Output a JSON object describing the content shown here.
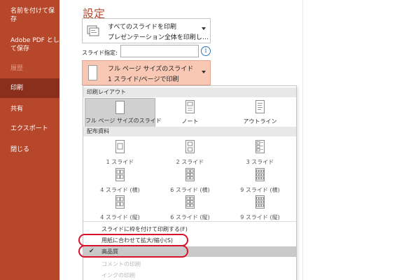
{
  "sidebar": {
    "items": [
      {
        "label": "名前を付けて保\n存"
      },
      {
        "label": "Adobe PDF とし\nて保存"
      },
      {
        "label": "履歴"
      },
      {
        "label": "印刷"
      },
      {
        "label": "共有"
      },
      {
        "label": "エクスポート"
      },
      {
        "label": "閉じる"
      }
    ]
  },
  "settings": {
    "title": "設定",
    "print_range": {
      "line1": "すべてのスライドを印刷",
      "line2": "プレゼンテーション全体を印刷し…"
    },
    "slides_label": "スライド指定:",
    "slides_value": "",
    "layout_dropdown": {
      "line1": "フル ページ サイズのスライド",
      "line2": "1 スライド/ページで印刷"
    }
  },
  "menu": {
    "layout_header": "印刷レイアウト",
    "layouts": [
      {
        "label": "フル ページ サイズのスライド"
      },
      {
        "label": "ノート"
      },
      {
        "label": "アウトライン"
      }
    ],
    "handout_header": "配布資料",
    "handouts": [
      {
        "label": "1 スライド"
      },
      {
        "label": "2 スライド"
      },
      {
        "label": "3 スライド"
      },
      {
        "label": "4 スライド (横)"
      },
      {
        "label": "6 スライド (横)"
      },
      {
        "label": "9 スライド (横)"
      },
      {
        "label": "4 スライド (縦)"
      },
      {
        "label": "6 スライド (縦)"
      },
      {
        "label": "9 スライド (縦)"
      }
    ],
    "options": [
      {
        "label": "スライドに枠を付けて印刷する(F)"
      },
      {
        "label": "用紙に合わせて拡大/縮小(S)"
      },
      {
        "label": "高品質"
      },
      {
        "label": "コメントの印刷"
      },
      {
        "label": "インクの印刷"
      }
    ]
  },
  "colors": {
    "sidebar_bg": "#b7472a",
    "sidebar_active": "#8a2f1c",
    "accent": "#b7472a",
    "highlight_dropdown": "#f9c8b5",
    "annotation": "#d9112a"
  }
}
